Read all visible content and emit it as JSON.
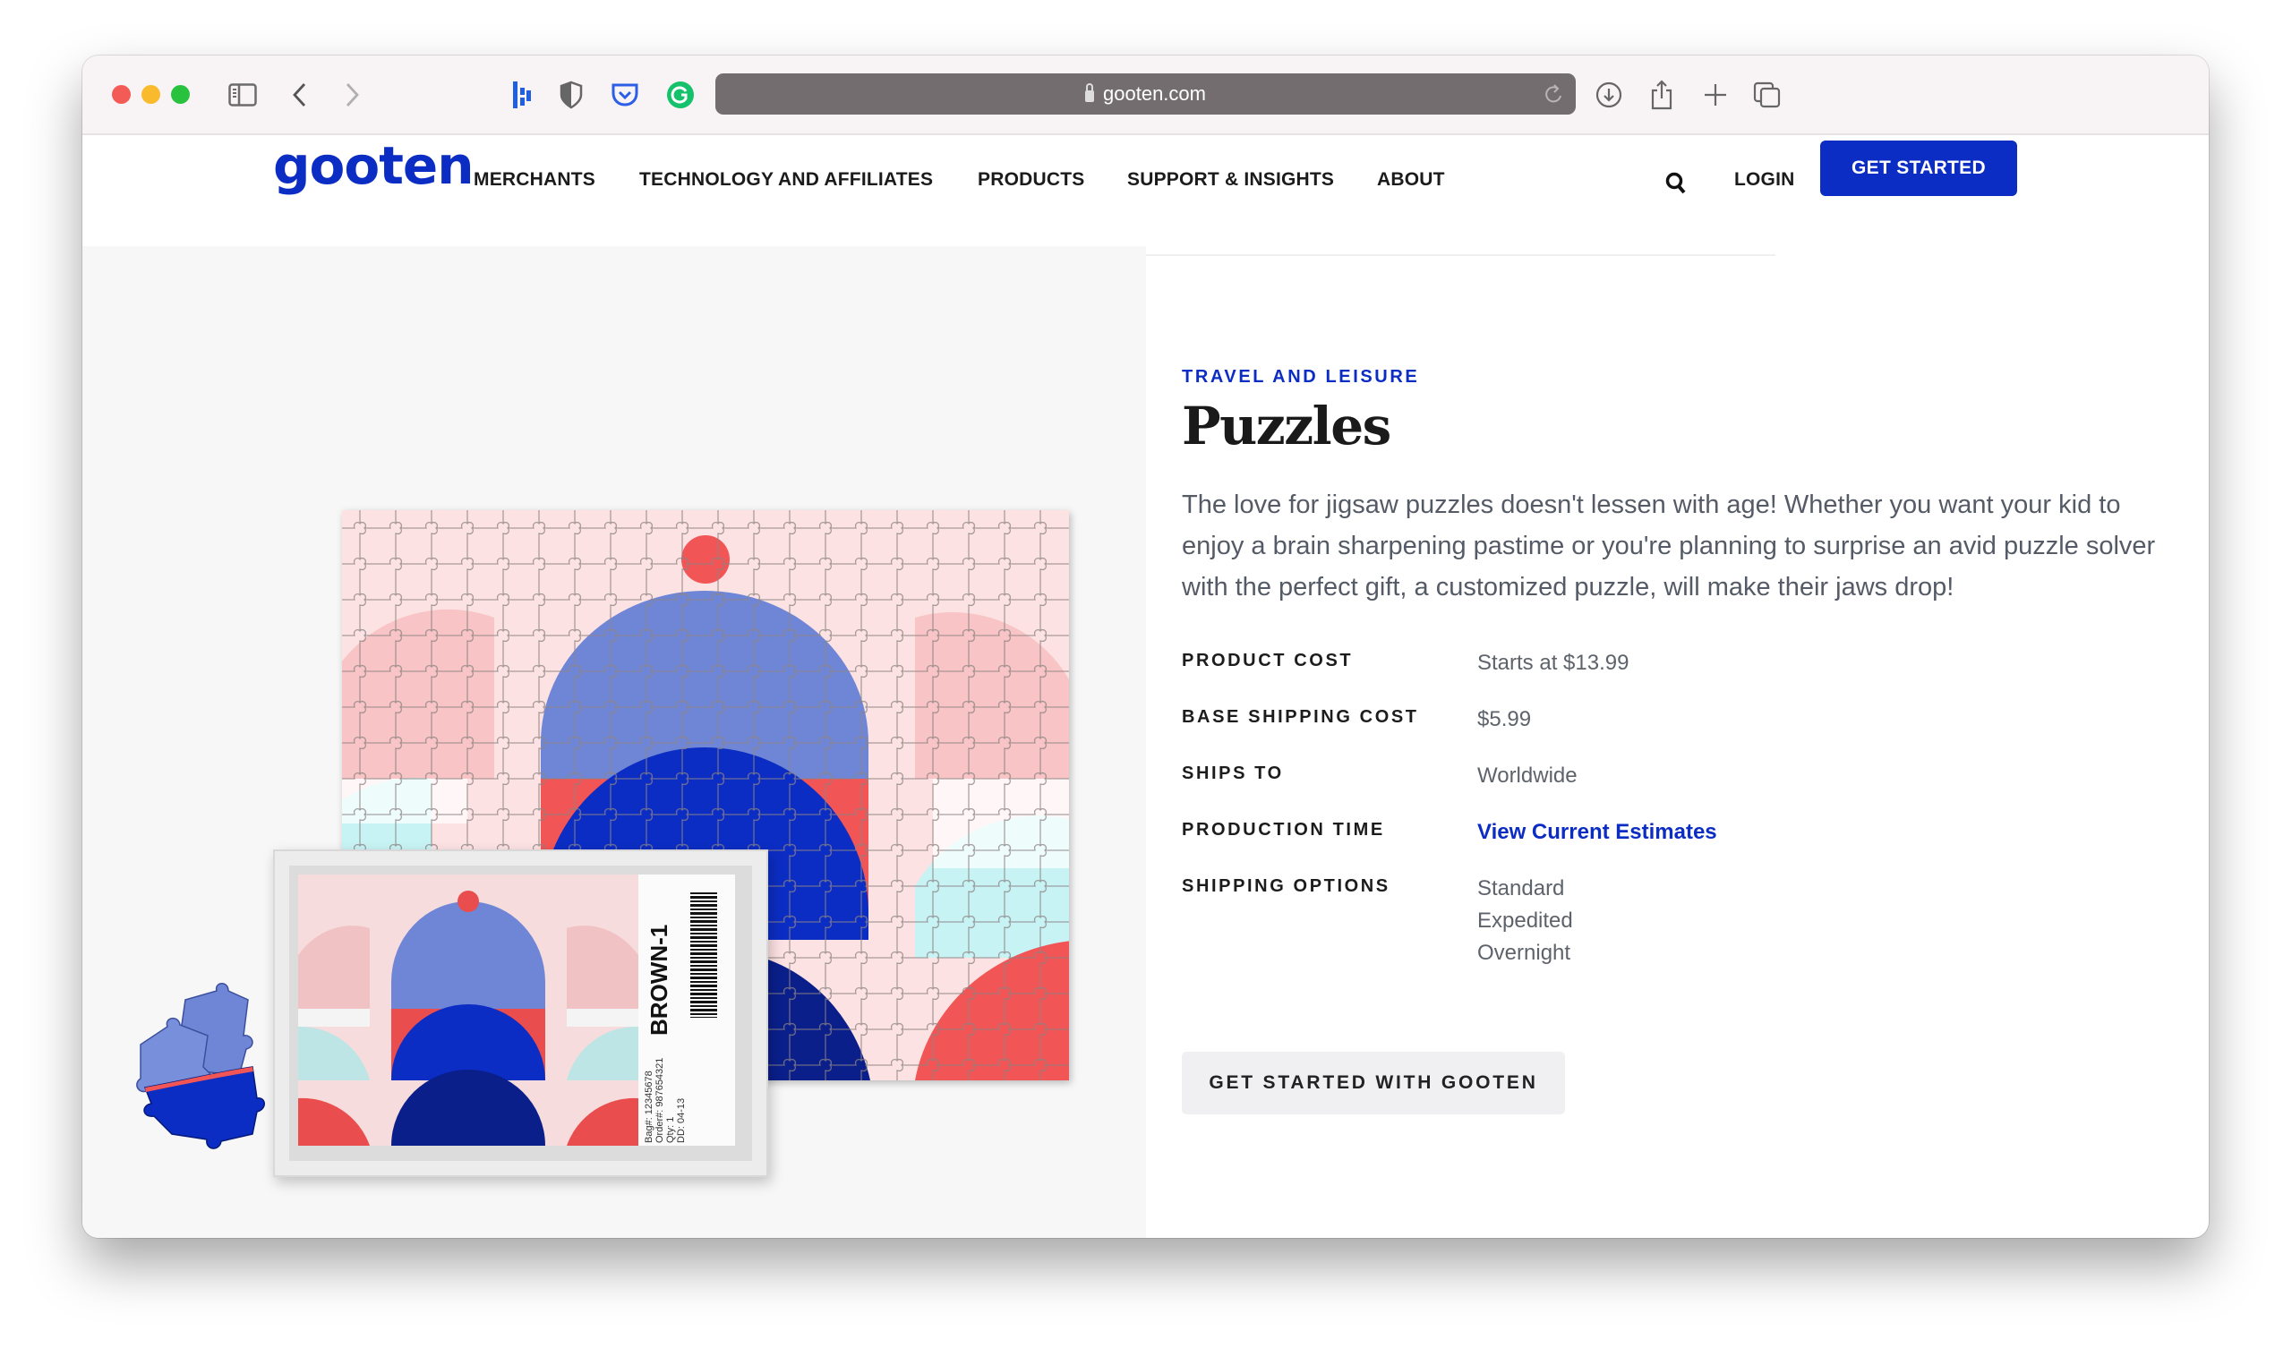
{
  "browser": {
    "url": "gooten.com",
    "toolbar_icons": [
      "sidebar-icon",
      "back-icon",
      "forward-icon",
      "dashlane-icon",
      "privacy-shield-icon",
      "pocket-icon",
      "grammarly-icon",
      "reload-icon",
      "downloads-icon",
      "share-icon",
      "new-tab-icon",
      "tab-overview-icon"
    ]
  },
  "header": {
    "logo": "gooten",
    "nav": [
      "MERCHANTS",
      "TECHNOLOGY AND AFFILIATES",
      "PRODUCTS",
      "SUPPORT & INSIGHTS",
      "ABOUT"
    ],
    "login": "LOGIN",
    "cta": "GET STARTED"
  },
  "product": {
    "category": "TRAVEL AND LEISURE",
    "title": "Puzzles",
    "description": "The love for jigsaw puzzles doesn't lessen with age! Whether you want your kid to enjoy a brain sharpening pastime or you're planning to surprise an avid puzzle solver with the perfect gift, a customized puzzle, will make their jaws drop!",
    "specs": [
      {
        "label": "PRODUCT COST",
        "value": "Starts at $13.99"
      },
      {
        "label": "BASE SHIPPING COST",
        "value": "$5.99"
      },
      {
        "label": "SHIPS TO",
        "value": "Worldwide"
      },
      {
        "label": "PRODUCTION TIME",
        "value": "View Current Estimates"
      },
      {
        "label": "SHIPPING OPTIONS",
        "values": [
          "Standard",
          "Expedited",
          "Overnight"
        ]
      }
    ],
    "button": "GET STARTED WITH GOOTEN"
  },
  "image": {
    "box_label": {
      "code": "BROWN-1",
      "bag": "Bag#: 12345678",
      "order": "Order#: 987654321",
      "qty": "Qty: 1",
      "dd": "DD: 04-13"
    }
  },
  "colors": {
    "brand": "#0b2dc3",
    "puzzle_pink": "#fde2e3",
    "puzzle_red": "#f25555",
    "puzzle_periwinkle": "#6f86d6",
    "puzzle_navy": "#0a1f8a",
    "puzzle_mint": "#c8f3f4"
  }
}
